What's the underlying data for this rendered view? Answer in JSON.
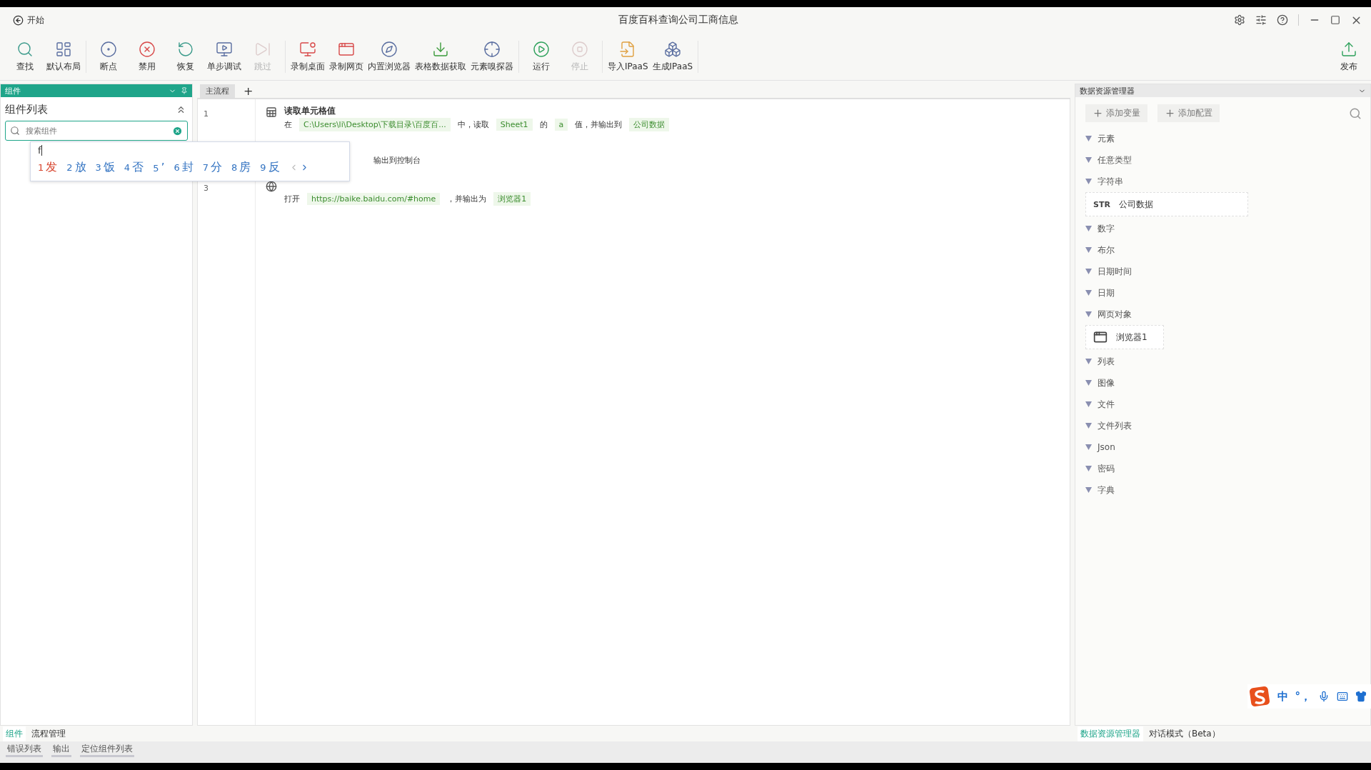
{
  "title_bar": {
    "back_label": "开始",
    "title": "百度百科查询公司工商信息"
  },
  "toolbar": {
    "groups": [
      [
        {
          "label": "查找",
          "disabled": false
        },
        {
          "label": "默认布局",
          "disabled": false
        }
      ],
      [
        {
          "label": "断点",
          "disabled": false
        },
        {
          "label": "禁用",
          "disabled": false
        },
        {
          "label": "恢复",
          "disabled": false
        },
        {
          "label": "单步调试",
          "disabled": false
        },
        {
          "label": "跳过",
          "disabled": true
        }
      ],
      [
        {
          "label": "录制桌面",
          "disabled": false
        },
        {
          "label": "录制网页",
          "disabled": false
        },
        {
          "label": "内置浏览器",
          "disabled": false
        },
        {
          "label": "表格数据获取",
          "disabled": false
        },
        {
          "label": "元素嗅探器",
          "disabled": false
        }
      ],
      [
        {
          "label": "运行",
          "disabled": false
        },
        {
          "label": "停止",
          "disabled": true
        }
      ],
      [
        {
          "label": "导入IPaaS",
          "disabled": false
        },
        {
          "label": "生成IPaaS",
          "disabled": false
        }
      ]
    ],
    "publish": {
      "label": "发布"
    }
  },
  "left_panel": {
    "header": "组件",
    "section_title": "组件列表",
    "search": {
      "placeholder": "搜索组件"
    },
    "tabs": [
      {
        "label": "组件",
        "selected": true
      },
      {
        "label": "流程管理",
        "selected": false
      }
    ]
  },
  "ime_popup": {
    "input": "f",
    "candidates": [
      {
        "index": "1",
        "text": "发",
        "selected": true
      },
      {
        "index": "2",
        "text": "放",
        "selected": false
      },
      {
        "index": "3",
        "text": "饭",
        "selected": false
      },
      {
        "index": "4",
        "text": "否",
        "selected": false
      },
      {
        "index": "5",
        "text": "’",
        "selected": false
      },
      {
        "index": "6",
        "text": "封",
        "selected": false
      },
      {
        "index": "7",
        "text": "分",
        "selected": false
      },
      {
        "index": "8",
        "text": "房",
        "selected": false
      },
      {
        "index": "9",
        "text": "反",
        "selected": false
      }
    ]
  },
  "editor": {
    "tabs": [
      {
        "label": "主流程",
        "selected": true
      }
    ],
    "add_tab": "+",
    "steps": [
      {
        "kind": "excel",
        "number": "1",
        "title": "读取单元格值",
        "parts": [
          {
            "kind": "text",
            "text": "在"
          },
          {
            "kind": "chip",
            "text": "C:\\Users\\li\\Desktop\\下载目录\\百度百..."
          },
          {
            "kind": "text",
            "text": "中，读取"
          },
          {
            "kind": "chip",
            "text": "Sheet1"
          },
          {
            "kind": "text",
            "text": "的"
          },
          {
            "kind": "chip",
            "text": "a"
          },
          {
            "kind": "text",
            "text": "值，并输出到"
          },
          {
            "kind": "chip",
            "text": "公司数据"
          }
        ]
      },
      {
        "parts": [
          {
            "kind": "tail",
            "text": "输出到控制台"
          }
        ]
      },
      {
        "kind": "browser",
        "number": "3",
        "parts": [
          {
            "kind": "text",
            "text": "打开"
          },
          {
            "kind": "chip",
            "text": "https://baike.baidu.com/#home"
          },
          {
            "kind": "text",
            "text": "，并输出为"
          },
          {
            "kind": "chip",
            "text": "浏览器1"
          }
        ]
      }
    ]
  },
  "data_panel": {
    "header": "数据资源管理器",
    "buttons": [
      "添加变量",
      "添加配置"
    ],
    "categories": [
      {
        "label": "元素"
      },
      {
        "label": "任意类型"
      },
      {
        "label": "字符串",
        "children": [
          {
            "kind": "str",
            "tag": "STR",
            "name": "公司数据"
          }
        ]
      },
      {
        "label": "数字"
      },
      {
        "label": "布尔"
      },
      {
        "label": "日期时间"
      },
      {
        "label": "日期"
      },
      {
        "label": "网页对象",
        "children": [
          {
            "kind": "browser",
            "name": "浏览器1"
          }
        ]
      },
      {
        "label": "列表"
      },
      {
        "label": "图像"
      },
      {
        "label": "文件"
      },
      {
        "label": "文件列表"
      },
      {
        "label": "Json"
      },
      {
        "label": "密码"
      },
      {
        "label": "字典"
      }
    ],
    "tabs": [
      {
        "label": "数据资源管理器",
        "selected": true
      },
      {
        "label": "对话模式（Beta）",
        "selected": false
      }
    ]
  },
  "output_tabs": [
    "错误列表",
    "输出",
    "定位组件列表"
  ],
  "ime_status": {
    "mode": "中",
    "punct": "°，"
  }
}
